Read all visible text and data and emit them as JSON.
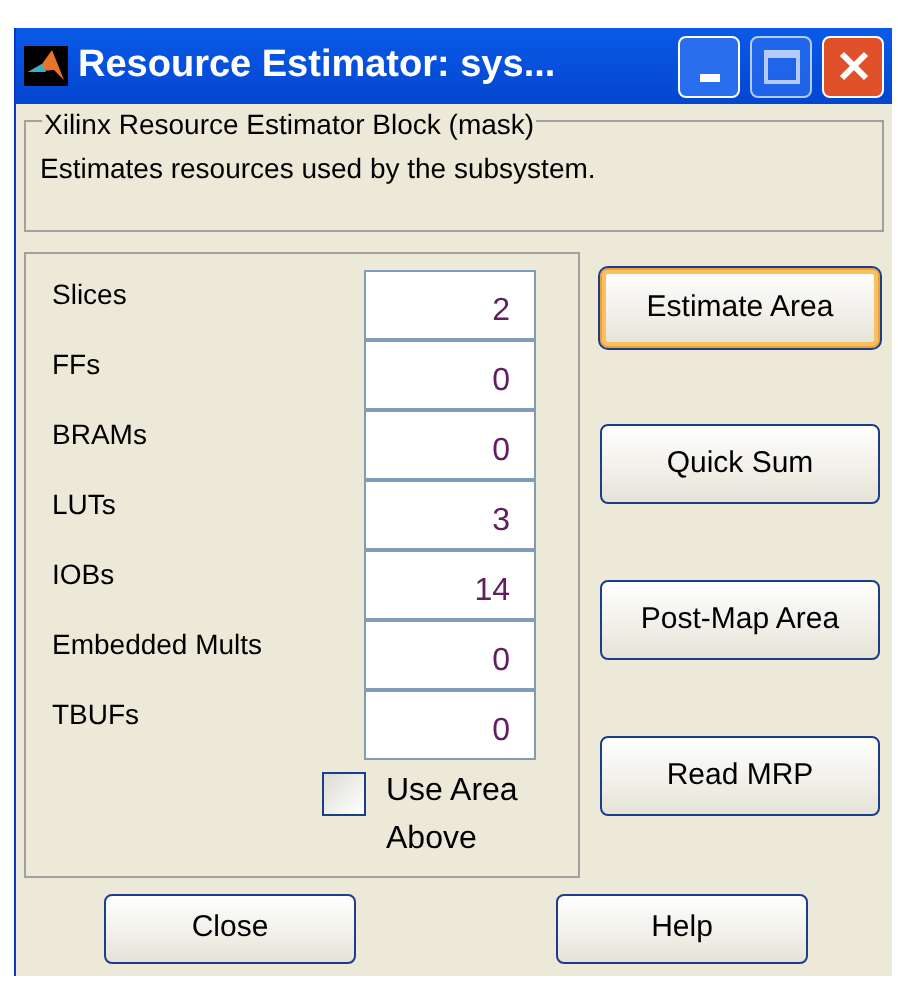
{
  "window": {
    "title": "Resource Estimator: sys..."
  },
  "group": {
    "title": "Xilinx Resource Estimator Block (mask)",
    "description": "Estimates resources used by the subsystem."
  },
  "resources": [
    {
      "label": "Slices",
      "value": "2"
    },
    {
      "label": "FFs",
      "value": "0"
    },
    {
      "label": "BRAMs",
      "value": "0"
    },
    {
      "label": "LUTs",
      "value": "3"
    },
    {
      "label": "IOBs",
      "value": "14"
    },
    {
      "label": "Embedded Mults",
      "value": "0"
    },
    {
      "label": "TBUFs",
      "value": "0"
    }
  ],
  "use_area_above": {
    "label": "Use Area Above",
    "checked": false
  },
  "actions": [
    {
      "label": "Estimate Area",
      "focused": true
    },
    {
      "label": "Quick Sum",
      "focused": false
    },
    {
      "label": "Post-Map Area",
      "focused": false
    },
    {
      "label": "Read MRP",
      "focused": false
    }
  ],
  "footer_buttons": [
    "Close",
    "Help"
  ]
}
